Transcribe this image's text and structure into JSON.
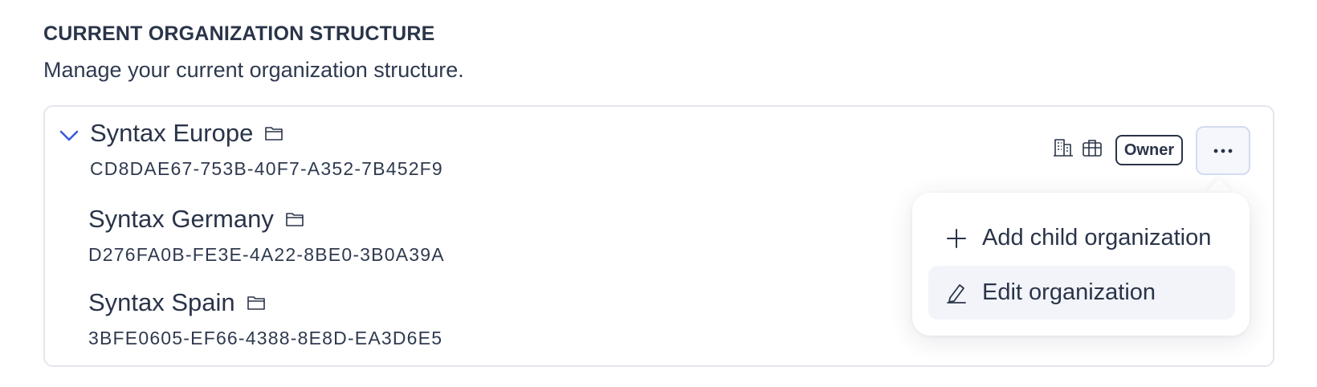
{
  "section": {
    "title": "CURRENT ORGANIZATION STRUCTURE",
    "description": "Manage your current organization structure."
  },
  "orgs": [
    {
      "name": "Syntax Europe",
      "id": "CD8DAE67-753B-40F7-A352-7B452F9",
      "expanded": true
    },
    {
      "name": "Syntax Germany",
      "id": "D276FA0B-FE3E-4A22-8BE0-3B0A39A"
    },
    {
      "name": "Syntax Spain",
      "id": "3BFE0605-EF66-4388-8E8D-EA3D6E5"
    }
  ],
  "row_actions": {
    "icons": [
      "building-icon",
      "briefcase-icon"
    ],
    "role_badge": "Owner",
    "more_icon": "ellipsis-icon"
  },
  "menu": {
    "items": [
      {
        "label": "Add child organization",
        "icon": "plus-icon"
      },
      {
        "label": "Edit organization",
        "icon": "pencil-icon",
        "highlighted": true
      }
    ]
  },
  "colors": {
    "text": "#2a3449",
    "accent": "#3b5bdb",
    "border": "#e3e6ef",
    "menu_highlight": "#f2f4f9"
  }
}
